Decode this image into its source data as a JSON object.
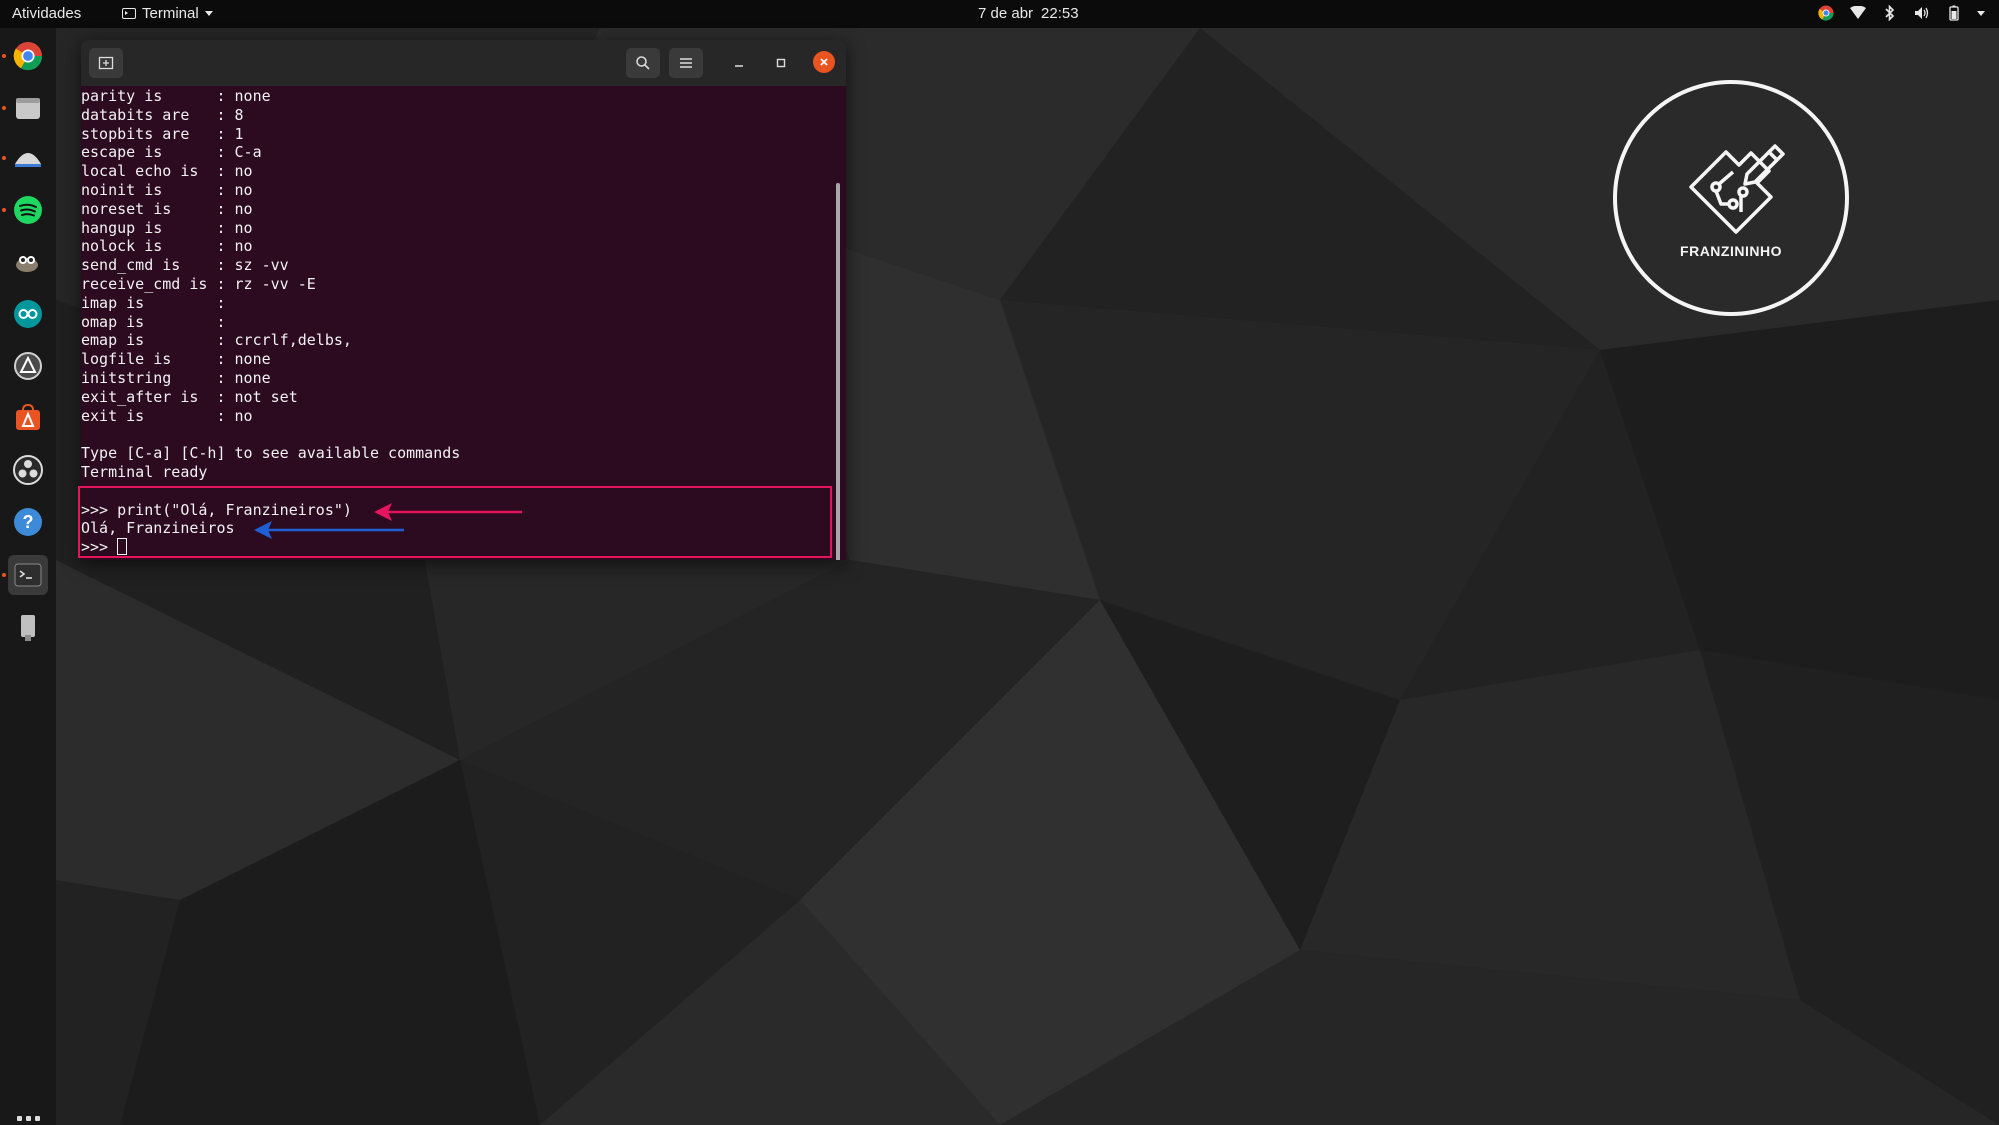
{
  "topbar": {
    "activities": "Atividades",
    "app_name": "Terminal",
    "date": "7 de abr",
    "time": "22:53",
    "tray_icons": [
      "chrome-icon",
      "wifi-icon",
      "bluetooth-icon",
      "volume-icon",
      "battery-icon",
      "system-menu-caret"
    ]
  },
  "dock": {
    "items": [
      {
        "name": "chrome",
        "icon": "chrome-icon",
        "running": true
      },
      {
        "name": "files",
        "icon": "files-icon",
        "running": true
      },
      {
        "name": "wireshark",
        "icon": "shark-fin-icon",
        "running": true
      },
      {
        "name": "spotify",
        "icon": "spotify-icon",
        "running": true
      },
      {
        "name": "gimp",
        "icon": "gimp-icon",
        "running": false
      },
      {
        "name": "arduino",
        "icon": "arduino-icon",
        "running": false
      },
      {
        "name": "software-updater",
        "icon": "updater-icon",
        "running": false
      },
      {
        "name": "ubuntu-software",
        "icon": "software-store-icon",
        "running": false
      },
      {
        "name": "obs",
        "icon": "obs-icon",
        "running": false
      },
      {
        "name": "help",
        "icon": "help-icon",
        "running": false
      },
      {
        "name": "terminal",
        "icon": "terminal-icon",
        "running": true
      },
      {
        "name": "usb-drive",
        "icon": "usb-drive-icon",
        "running": false
      }
    ],
    "show_apps_icon": "app-grid-icon"
  },
  "terminal": {
    "lines": [
      "parity is      : none",
      "databits are   : 8",
      "stopbits are   : 1",
      "escape is      : C-a",
      "local echo is  : no",
      "noinit is      : no",
      "noreset is     : no",
      "hangup is      : no",
      "nolock is      : no",
      "send_cmd is    : sz -vv",
      "receive_cmd is : rz -vv -E",
      "imap is        :",
      "omap is        :",
      "emap is        : crcrlf,delbs,",
      "logfile is     : none",
      "initstring     : none",
      "exit_after is  : not set",
      "exit is        : no",
      "",
      "Type [C-a] [C-h] to see available commands",
      "Terminal ready",
      "",
      ">>> print(\"Olá, Franzineiros\")",
      "Olá, Franzineiros",
      ">>> "
    ],
    "highlight_color": "#e4155c",
    "input_arrow_color": "#e4155c",
    "output_arrow_color": "#1f5fd6",
    "background": "#2c0a20"
  },
  "logo": {
    "text": "FRANZININHO"
  },
  "colors": {
    "ubuntu_orange": "#e95420",
    "topbar": "#0b0b0b",
    "dock": "#181818"
  }
}
